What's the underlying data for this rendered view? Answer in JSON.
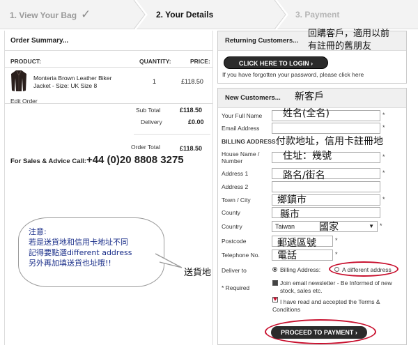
{
  "steps": {
    "step1": "1.  View Your Bag",
    "step1_check": "✓",
    "step2": "2.  Your Details",
    "step3": "3.  Payment"
  },
  "order": {
    "title": "Order Summary...",
    "headers": {
      "product": "PRODUCT:",
      "quantity": "QUANTITY:",
      "price": "PRICE:"
    },
    "item": {
      "name": "Monteria Brown Leather Biker Jacket - Size: UK Size 8",
      "quantity": "1",
      "price": "£118.50"
    },
    "edit_label": "Edit Order",
    "subtotal_label": "Sub Total",
    "subtotal": "£118.50",
    "delivery_label": "Delivery",
    "delivery": "£0.00",
    "total_label": "Order Total",
    "total": "£118.50",
    "sales_label": "For Sales & Advice Call:",
    "sales_phone": "+44 (0)20 8808 3275"
  },
  "returning": {
    "title": "Returning Customers...",
    "login_button": "CLICK HERE TO LOGIN ›",
    "forgot_text": "If you have forgotten your password, please click here"
  },
  "new_customers": {
    "title": "New Customers...",
    "full_name": "Your Full Name",
    "email": "Email Address",
    "billing_title": "BILLING ADDRESS:",
    "house": "House Name / Number",
    "address1": "Address 1",
    "address2": "Address 2",
    "town": "Town / City",
    "county": "County",
    "country": "Country",
    "country_value": "Taiwan",
    "postcode": "Postcode",
    "telephone": "Telephone No.",
    "deliver_to": "Deliver to",
    "billing_option": "Billing Address:",
    "different_option": "A different address",
    "required": "* Required",
    "newsletter": "Join email newsletter - Be Informed of new stock, sales etc.",
    "terms": "I have read and accepted the Terms & Conditions",
    "proceed_button": "PROCEED TO PAYMENT ›",
    "asterisk": "*"
  },
  "annotations": {
    "returning": "回購客戶，適用以前\n有註冊的舊朋友",
    "new_customer": "新客戶",
    "name": "姓名(全名)",
    "billing": "付款地址，信用卡註冊地",
    "house": "住址：幾號",
    "road": "路名/街名",
    "town": "鄉鎮市",
    "county": "縣市",
    "country": "國家",
    "postcode": "郵遞區號",
    "phone": "電話",
    "bubble_line1": "注意:",
    "bubble_line2": "若是送貨地和信用卡地址不同",
    "bubble_line3": "記得要點選different address",
    "bubble_line4": "另外再加填送貨也址哦!!",
    "ship": "送貨地"
  },
  "colors": {
    "accent_red": "#c8102e",
    "button_dark": "#2b2b2b",
    "note_blue": "#1b2f8a"
  }
}
